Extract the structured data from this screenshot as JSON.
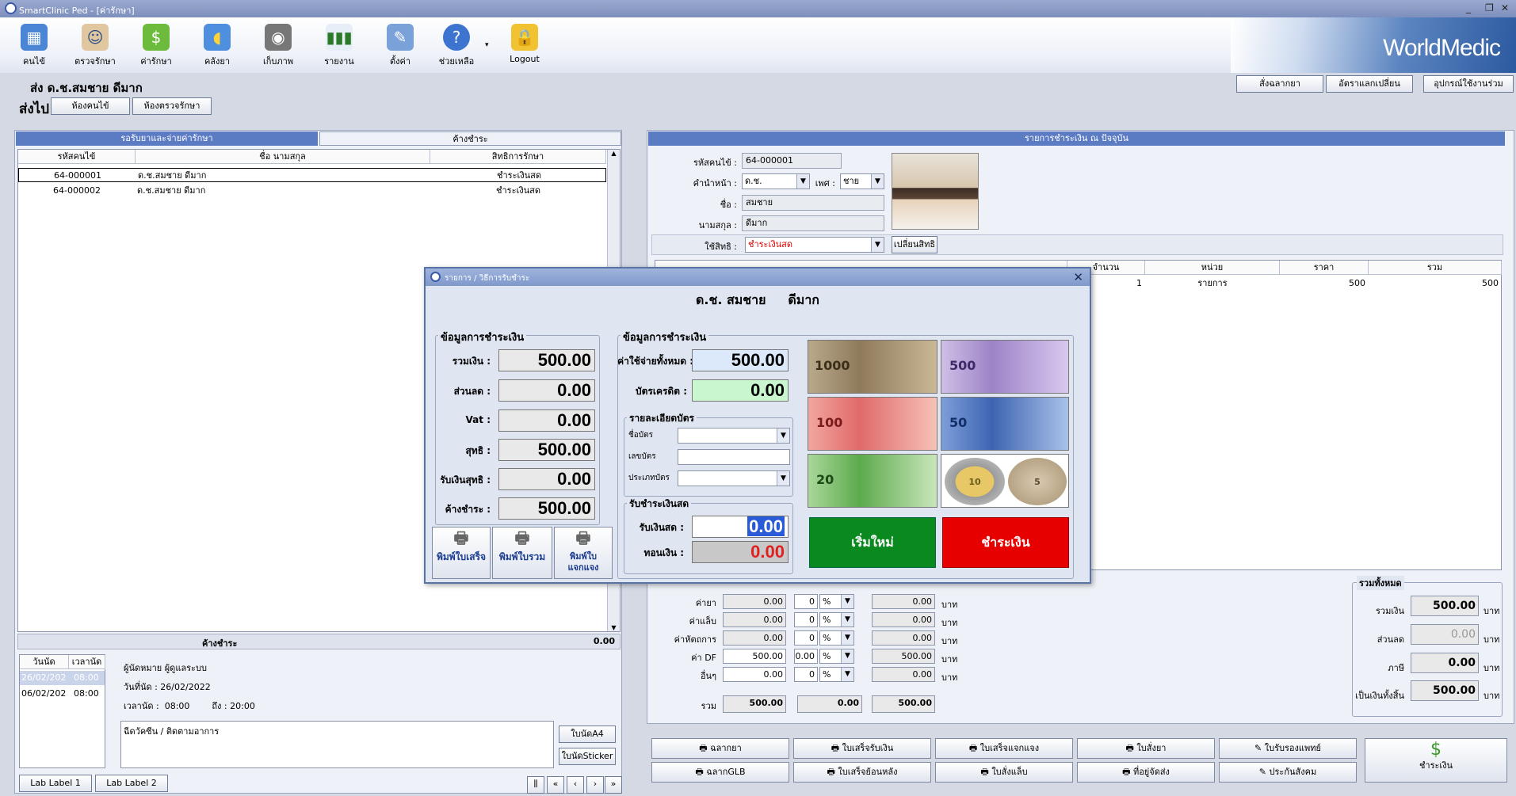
{
  "window": {
    "title": "SmartClinic Ped - [ค่ารักษา]"
  },
  "toolbar": {
    "items": [
      "คนไข้",
      "ตรวจรักษา",
      "ค่ารักษา",
      "คลังยา",
      "เก็บภาพ",
      "รายงาน",
      "ตั้งค่า",
      "ช่วยเหลือ",
      "Logout"
    ],
    "brand": "WorldMedic"
  },
  "header": {
    "send_label": "ส่ง  ด.ช.สมชาย ดีมาก",
    "sendto_label": "ส่งไป",
    "btn_patient_room": "ห้องคนไข้",
    "btn_exam_room": "ห้องตรวจรักษา",
    "btn_order_label": "สั่งฉลากยา",
    "btn_exchange_rate": "อัตราแลกเปลี่ยน",
    "btn_equipment": "อุปกรณ์ใช้งานร่วม"
  },
  "left": {
    "tab_waiting": "รอรับยาและจ่ายค่ารักษา",
    "tab_pending": "ค้างชำระ",
    "columns": [
      "รหัสคนไข้",
      "ชื่อ นามสกุล",
      "สิทธิการรักษา"
    ],
    "rows": [
      [
        "64-000001",
        "ด.ช.สมชาย ดีมาก",
        "ชำระเงินสด"
      ],
      [
        "64-000002",
        "ด.ช.สมชาย ดีมาก",
        "ชำระเงินสด"
      ]
    ],
    "pending_label": "ค้างชำระ",
    "pending_value": "0.00",
    "appt_cols": [
      "วันนัด",
      "เวลานัด"
    ],
    "appt_rows": [
      [
        "26/02/202",
        "08:00"
      ],
      [
        "06/02/202",
        "08:00"
      ]
    ],
    "appt_by": "ผู้นัดหมาย ผู้ดูแลระบบ",
    "appt_date": "วันที่นัด :  26/02/2022",
    "appt_time": "เวลานัด :  08:00        ถึง : 20:00",
    "appt_note": "ฉีดวัคซีน / ติดตามอาการ",
    "btn_a4": "ใบนัดA4",
    "btn_sticker": "ใบนัดSticker",
    "btn_lab1": "Lab Label 1",
    "btn_lab2": "Lab Label 2"
  },
  "right": {
    "section_title": "รายการชำระเงิน ณ ปัจจุบัน",
    "hn_label": "รหัสคนไข้ :",
    "hn": "64-000001",
    "prefix_label": "คำนำหน้า :",
    "prefix": "ด.ช.",
    "sex_label": "เพศ :",
    "sex": "ชาย",
    "name_label": "ชื่อ :",
    "name": "สมชาย",
    "surname_label": "นามสกุล :",
    "surname": "ดีมาก",
    "right_label": "ใช้สิทธิ :",
    "right_value": "ชำระเงินสด",
    "btn_change_right": "เปลี่ยนสิทธิ",
    "item_cols": [
      "จำนวน",
      "หน่วย",
      "ราคา",
      "รวม"
    ],
    "item_row": [
      "1",
      "รายการ",
      "500",
      "500"
    ],
    "charges": [
      {
        "label": "ค่ายา",
        "val": "0.00",
        "disc": "0",
        "pct": "%",
        "net": "0.00",
        "unit": "บาท"
      },
      {
        "label": "ค่าแล็บ",
        "val": "0.00",
        "disc": "0",
        "pct": "%",
        "net": "0.00",
        "unit": "บาท"
      },
      {
        "label": "ค่าหัตถการ",
        "val": "0.00",
        "disc": "0",
        "pct": "%",
        "net": "0.00",
        "unit": "บาท"
      },
      {
        "label": "ค่า DF",
        "val": "500.00",
        "disc": "0.00",
        "pct": "%",
        "net": "500.00",
        "unit": "บาท"
      },
      {
        "label": "อื่นๆ",
        "val": "0.00",
        "disc": "0",
        "pct": "%",
        "net": "0.00",
        "unit": "บาท"
      }
    ],
    "sum_label": "รวม",
    "sum_val": "500.00",
    "sum_disc": "0.00",
    "sum_net": "500.00",
    "total_group": "รวมทั้งหมด",
    "totals": [
      {
        "label": "รวมเงิน",
        "val": "500.00",
        "unit": "บาท"
      },
      {
        "label": "ส่วนลด",
        "val": "0.00",
        "unit": "บาท"
      },
      {
        "label": "ภาษี",
        "val": "0.00",
        "unit": "บาท"
      },
      {
        "label": "เป็นเงินทั้งสิ้น",
        "val": "500.00",
        "unit": "บาท"
      }
    ],
    "bottom_buttons": [
      "ฉลากยา",
      "ใบเสร็จรับเงิน",
      "ใบเสร็จแจกแจง",
      "ใบสั่งยา",
      "ใบรับรองแพทย์",
      "ฉลากGLB",
      "ใบเสร็จย้อนหลัง",
      "ใบสั่งแล็บ",
      "ที่อยู่จัดส่ง",
      "ประกันสังคม"
    ],
    "pay_button": "ชำระเงิน"
  },
  "dialog": {
    "title": "รายการ / วิธีการรับชำระ",
    "patient": "ด.ช. สมชาย     ดีมาก",
    "grp1": "ข้อมูลการชำระเงิน",
    "left_rows": [
      {
        "label": "รวมเงิน :",
        "val": "500.00"
      },
      {
        "label": "ส่วนลด :",
        "val": "0.00"
      },
      {
        "label": "Vat :",
        "val": "0.00"
      },
      {
        "label": "สุทธิ :",
        "val": "500.00"
      },
      {
        "label": "รับเงินสุทธิ :",
        "val": "0.00"
      },
      {
        "label": "ค้างชำระ :",
        "val": "500.00"
      }
    ],
    "print_buttons": [
      "พิมพ์ใบเสร็จ",
      "พิมพ์ใบรวม",
      "พิมพ์ใบแจกแจง"
    ],
    "grp2": "ข้อมูลการชำระเงิน",
    "total_label": "ค่าใช้จ่ายทั้งหมด :",
    "total_val": "500.00",
    "card_label": "บัตรเครดิต :",
    "card_val": "0.00",
    "card_group": "รายละเอียดบัตร",
    "card_name": "ชื่อบัตร",
    "card_no": "เลขบัตร",
    "card_type": "ประเภทบัตร",
    "cash_group": "รับชำระเงินสด",
    "cash_label": "รับเงินสด :",
    "cash_val": "0.00",
    "change_label": "ทอนเงิน :",
    "change_val": "0.00",
    "notes": [
      "1000",
      "500",
      "100",
      "50",
      "20",
      "10",
      "5"
    ],
    "btn_reset": "เริ่มใหม่",
    "btn_pay": "ชำระเงิน"
  },
  "colors": {
    "accent": "#5b7bc3",
    "green": "#0a8a1e",
    "red": "#e60000"
  }
}
